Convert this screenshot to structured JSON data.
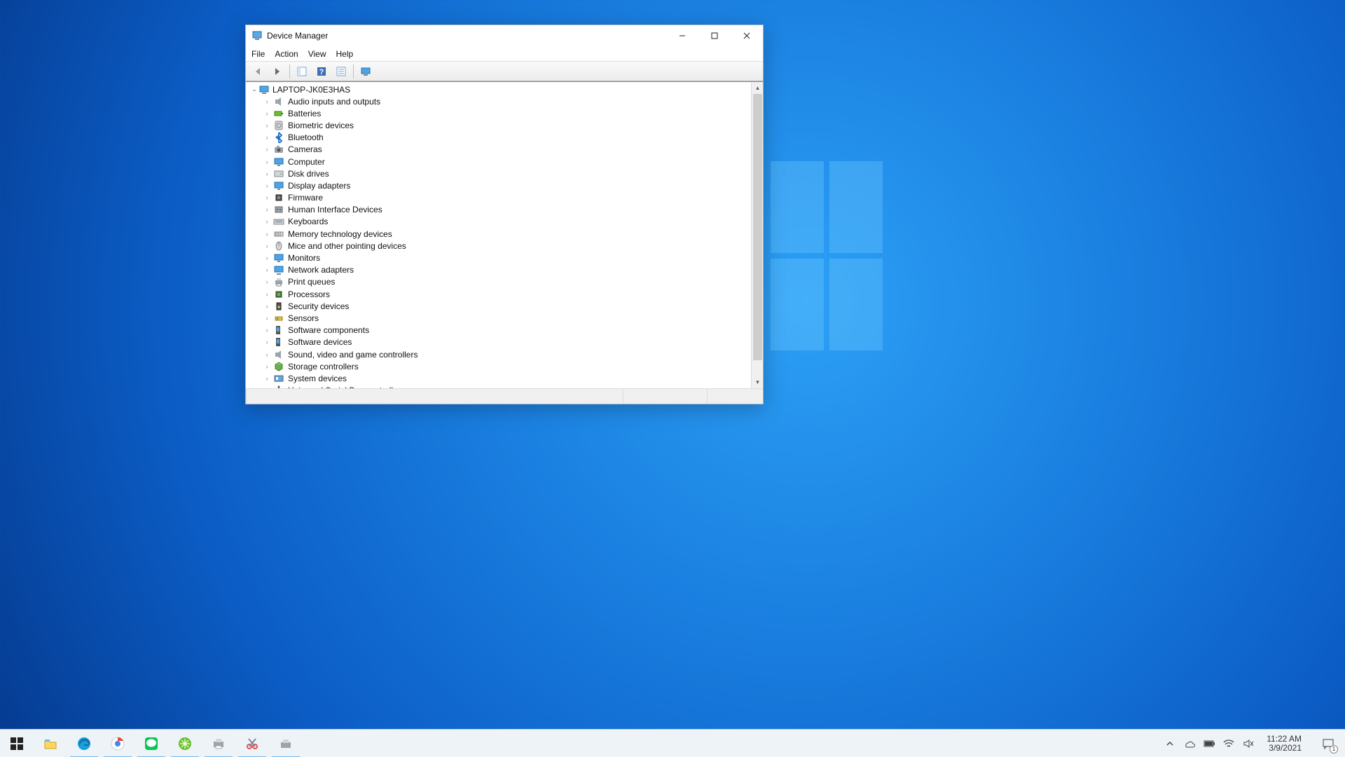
{
  "window": {
    "title": "Device Manager",
    "menus": [
      "File",
      "Action",
      "View",
      "Help"
    ],
    "root": "LAPTOP-JK0E3HAS",
    "categories": [
      {
        "label": "Audio inputs and outputs",
        "icon": "speaker"
      },
      {
        "label": "Batteries",
        "icon": "battery"
      },
      {
        "label": "Biometric devices",
        "icon": "biometric"
      },
      {
        "label": "Bluetooth",
        "icon": "bluetooth"
      },
      {
        "label": "Cameras",
        "icon": "camera"
      },
      {
        "label": "Computer",
        "icon": "monitor"
      },
      {
        "label": "Disk drives",
        "icon": "disk"
      },
      {
        "label": "Display adapters",
        "icon": "monitor"
      },
      {
        "label": "Firmware",
        "icon": "chip"
      },
      {
        "label": "Human Interface Devices",
        "icon": "hid"
      },
      {
        "label": "Keyboards",
        "icon": "keyboard"
      },
      {
        "label": "Memory technology devices",
        "icon": "memory"
      },
      {
        "label": "Mice and other pointing devices",
        "icon": "mouse"
      },
      {
        "label": "Monitors",
        "icon": "monitor"
      },
      {
        "label": "Network adapters",
        "icon": "network"
      },
      {
        "label": "Print queues",
        "icon": "printer"
      },
      {
        "label": "Processors",
        "icon": "cpu"
      },
      {
        "label": "Security devices",
        "icon": "security"
      },
      {
        "label": "Sensors",
        "icon": "sensor"
      },
      {
        "label": "Software components",
        "icon": "software"
      },
      {
        "label": "Software devices",
        "icon": "software"
      },
      {
        "label": "Sound, video and game controllers",
        "icon": "speaker"
      },
      {
        "label": "Storage controllers",
        "icon": "storage"
      },
      {
        "label": "System devices",
        "icon": "system"
      },
      {
        "label": "Universal Serial Bus controllers",
        "icon": "usb"
      }
    ]
  },
  "taskbar": {
    "time": "11:22 AM",
    "date": "3/9/2021",
    "notification_count": "1"
  }
}
